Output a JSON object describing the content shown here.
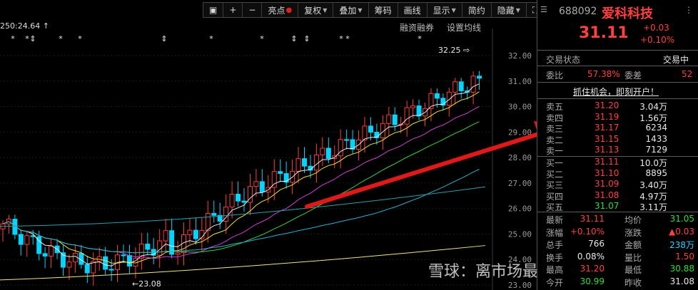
{
  "toolbar": {
    "items": [
      {
        "label": "▣",
        "dropdown": false
      },
      {
        "label": "+",
        "dropdown": false
      },
      {
        "label": "−",
        "dropdown": false
      },
      {
        "label": "亮点",
        "dropdown": false,
        "dot": true
      },
      {
        "label": "复权",
        "dropdown": true
      },
      {
        "label": "叠加",
        "dropdown": true
      },
      {
        "label": "筹码",
        "dropdown": false
      },
      {
        "label": "画线",
        "dropdown": false
      },
      {
        "label": "显示",
        "dropdown": true
      },
      {
        "label": "简约",
        "dropdown": false
      },
      {
        "label": "隐藏",
        "dropdown": true
      },
      {
        "label": "⛶",
        "dropdown": false
      }
    ]
  },
  "chart": {
    "ma_label": "250:24.64 ↑",
    "margin_label": "融资融券",
    "settings_label": "设置均线",
    "high_label": "32.25 ⇨",
    "low_label": "←23.08",
    "y_ticks": [
      "32.00",
      "31.00",
      "30.00",
      "29.00",
      "28.00",
      "27.00",
      "26.00",
      "25.00",
      "24.00",
      "23.00"
    ],
    "watermark": "雪球：离市场最近的兔子"
  },
  "stock": {
    "code": "688092",
    "name": "爱科科技",
    "price": "31.11",
    "change": "+0.03",
    "change_pct": "+0.10%"
  },
  "status": {
    "label": "交易状态",
    "value": "交易中",
    "weibi_label": "委比",
    "weibi_value": "57.38%",
    "weicha_label": "委差",
    "weicha_value": "52"
  },
  "promo": "抓住机会，即刻开户！",
  "order_book": {
    "asks": [
      {
        "label": "卖五",
        "price": "31.20",
        "vol": "3.04万"
      },
      {
        "label": "卖四",
        "price": "31.19",
        "vol": "1.56万"
      },
      {
        "label": "卖三",
        "price": "31.17",
        "vol": "6234"
      },
      {
        "label": "卖二",
        "price": "31.15",
        "vol": "1433"
      },
      {
        "label": "卖一",
        "price": "31.13",
        "vol": "7129"
      }
    ],
    "bids": [
      {
        "label": "买一",
        "price": "31.11",
        "vol": "10.0万"
      },
      {
        "label": "买二",
        "price": "31.10",
        "vol": "8895"
      },
      {
        "label": "买三",
        "price": "31.09",
        "vol": "3.40万"
      },
      {
        "label": "买四",
        "price": "31.08",
        "vol": "4.97万"
      },
      {
        "label": "买五",
        "price": "31.07",
        "vol": "3.11万"
      }
    ]
  },
  "stats": [
    {
      "l1": "最新",
      "v1": "31.11",
      "c1": "red",
      "l2": "均价",
      "v2": "31.05",
      "c2": "green"
    },
    {
      "l1": "涨幅",
      "v1": "+0.10%",
      "c1": "red",
      "l2": "涨跌",
      "v2": "▲0.03",
      "c2": "red"
    },
    {
      "l1": "总手",
      "v1": "766",
      "c1": "white",
      "l2": "金额",
      "v2": "238万",
      "c2": "cyan"
    },
    {
      "l1": "换手",
      "v1": "0.08%",
      "c1": "white",
      "l2": "量比",
      "v2": "1.50",
      "c2": "red"
    },
    {
      "l1": "最高",
      "v1": "31.20",
      "c1": "red",
      "l2": "最低",
      "v2": "30.88",
      "c2": "green"
    },
    {
      "l1": "今开",
      "v1": "30.99",
      "c1": "green",
      "l2": "昨收",
      "v2": "31.08",
      "c2": "white"
    }
  ]
}
